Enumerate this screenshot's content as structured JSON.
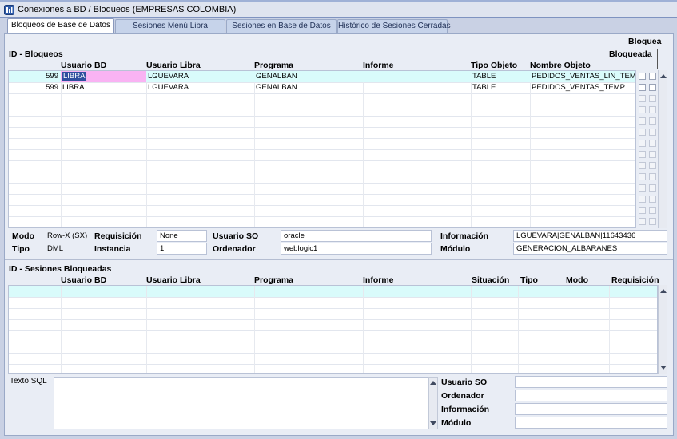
{
  "window": {
    "title": "Conexiones a BD / Bloqueos (EMPRESAS COLOMBIA)"
  },
  "tabs": [
    {
      "label": "Bloqueos de Base de Datos",
      "active": true
    },
    {
      "label": "Sesiones Menú Libra",
      "active": false
    },
    {
      "label": "Sesiones en Base de Datos",
      "active": false
    },
    {
      "label": "Histórico de Sesiones Cerradas",
      "active": false
    }
  ],
  "bloqueos": {
    "section_title": "ID - Bloqueos",
    "bloquea_header": "Bloquea",
    "bloqueada_header": "Bloqueada",
    "columns": [
      "Usuario BD",
      "Usuario Libra",
      "Programa",
      "Informe",
      "Tipo Objeto",
      "Nombre Objeto"
    ],
    "rows": [
      {
        "id": "599",
        "usuario_bd": "LIBRA",
        "usuario_libra": "LGUEVARA",
        "programa": "GENALBAN",
        "informe": "",
        "tipo_objeto": "TABLE",
        "nombre_objeto": "PEDIDOS_VENTAS_LIN_TEMP"
      },
      {
        "id": "599",
        "usuario_bd": "LIBRA",
        "usuario_libra": "LGUEVARA",
        "programa": "GENALBAN",
        "informe": "",
        "tipo_objeto": "TABLE",
        "nombre_objeto": "PEDIDOS_VENTAS_TEMP"
      }
    ]
  },
  "detail": {
    "modo_label": "Modo",
    "modo_value": "Row-X (SX)",
    "tipo_label": "Tipo",
    "tipo_value": "DML",
    "requisicion_label": "Requisición",
    "requisicion_value": "None",
    "instancia_label": "Instancia",
    "instancia_value": "1",
    "usuario_so_label": "Usuario SO",
    "usuario_so_value": "oracle",
    "ordenador_label": "Ordenador",
    "ordenador_value": "weblogic1",
    "informacion_label": "Información",
    "informacion_value": "LGUEVARA|GENALBAN|11643436",
    "modulo_label": "Módulo",
    "modulo_value": "GENERACION_ALBARANES"
  },
  "sesiones": {
    "section_title": "ID - Sesiones Bloqueadas",
    "columns": [
      "Usuario BD",
      "Usuario Libra",
      "Programa",
      "Informe",
      "Situación",
      "Tipo",
      "Modo",
      "Requisición"
    ]
  },
  "sql": {
    "label": "Texto SQL",
    "usuario_so_label": "Usuario SO",
    "ordenador_label": "Ordenador",
    "informacion_label": "Información",
    "modulo_label": "Módulo"
  },
  "colors": {
    "selected_row": "#d9fbfb",
    "selected_cell": "#f9b3f3",
    "title_bar": "#dfe4ef",
    "panel": "#e9edf5"
  }
}
